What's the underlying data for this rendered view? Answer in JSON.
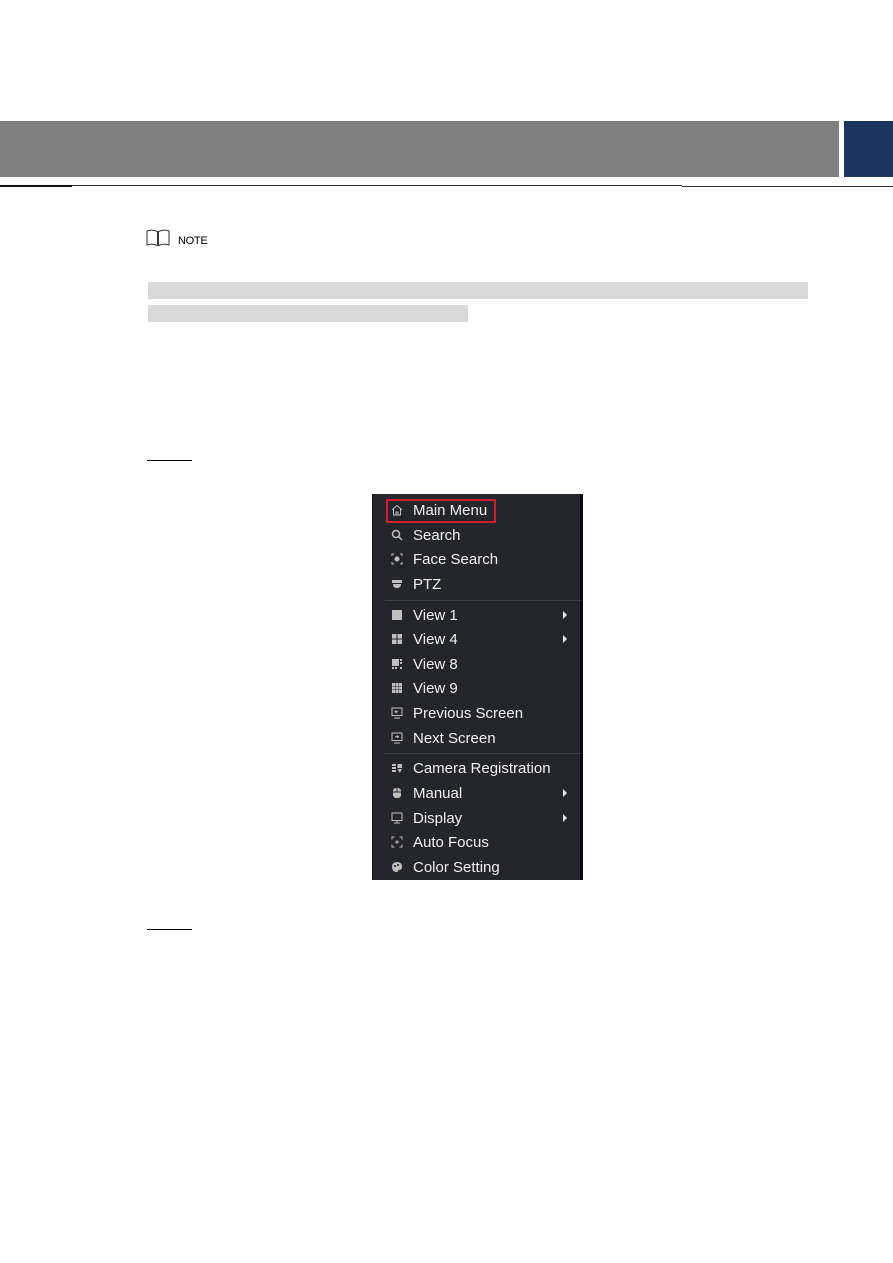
{
  "header": {
    "bar_color": "#808080",
    "accent_color": "#1b365d"
  },
  "note": {
    "icon": "book-icon",
    "label": "NOTE"
  },
  "steps": [
    {
      "underline": true
    },
    {
      "underline": true
    }
  ],
  "menu": {
    "highlight_color": "#d0202b",
    "groups": [
      [
        {
          "label": "Main Menu",
          "icon": "home-icon",
          "submenu": false,
          "highlighted": true
        },
        {
          "label": "Search",
          "icon": "search-icon",
          "submenu": false
        },
        {
          "label": "Face Search",
          "icon": "face-search-icon",
          "submenu": false
        },
        {
          "label": "PTZ",
          "icon": "ptz-camera-icon",
          "submenu": false
        }
      ],
      [
        {
          "label": "View 1",
          "icon": "view-1-icon",
          "submenu": true
        },
        {
          "label": "View 4",
          "icon": "view-4-icon",
          "submenu": true
        },
        {
          "label": "View 8",
          "icon": "view-8-icon",
          "submenu": false
        },
        {
          "label": "View 9",
          "icon": "view-9-icon",
          "submenu": false
        },
        {
          "label": "Previous Screen",
          "icon": "previous-screen-icon",
          "submenu": false
        },
        {
          "label": "Next Screen",
          "icon": "next-screen-icon",
          "submenu": false
        }
      ],
      [
        {
          "label": "Camera Registration",
          "icon": "camera-registration-icon",
          "submenu": false
        },
        {
          "label": "Manual",
          "icon": "manual-icon",
          "submenu": true
        },
        {
          "label": "Display",
          "icon": "display-icon",
          "submenu": true
        },
        {
          "label": "Auto Focus",
          "icon": "auto-focus-icon",
          "submenu": false
        },
        {
          "label": "Color Setting",
          "icon": "color-setting-icon",
          "submenu": false
        }
      ]
    ]
  }
}
